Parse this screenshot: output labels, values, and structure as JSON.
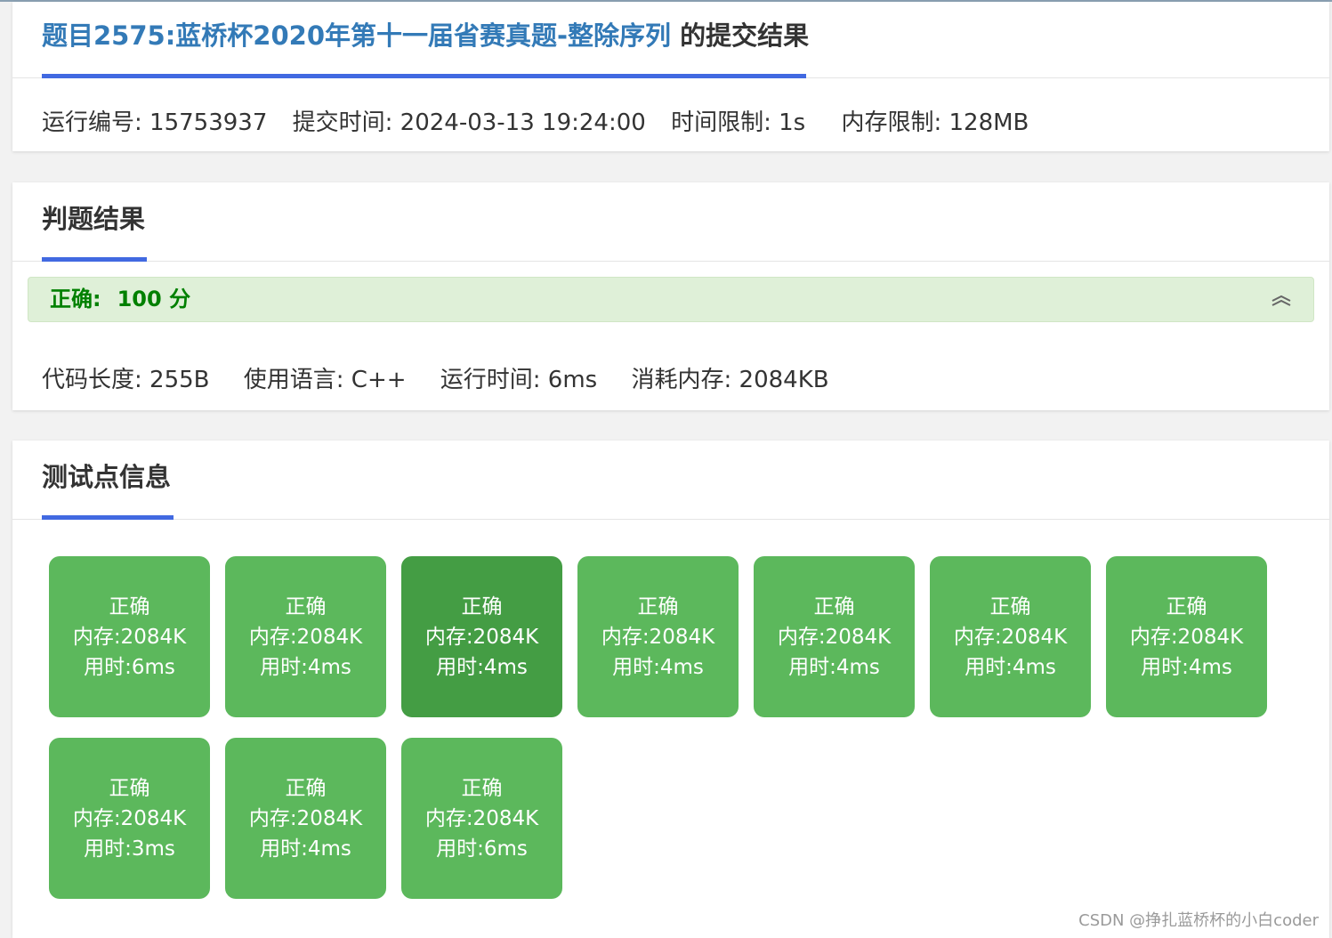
{
  "header": {
    "problem_link": "题目2575:蓝桥杯2020年第十一届省赛真题-整除序列",
    "title_suffix": " 的提交结果",
    "run_id": "运行编号: 15753937",
    "submit_time": "提交时间: 2024-03-13 19:24:00",
    "time_limit": "时间限制: 1s",
    "memory_limit": "内存限制: 128MB"
  },
  "judge": {
    "section_title": "判题结果",
    "verdict": "正确:",
    "score": "100 分",
    "code_length": "代码长度: 255B",
    "language": "使用语言: C++",
    "run_time": "运行时间: 6ms",
    "memory_used": "消耗内存: 2084KB"
  },
  "tests": {
    "section_title": "测试点信息",
    "items": [
      {
        "status": "正确",
        "memory": "内存:2084K",
        "time": "用时:6ms"
      },
      {
        "status": "正确",
        "memory": "内存:2084K",
        "time": "用时:4ms"
      },
      {
        "status": "正确",
        "memory": "内存:2084K",
        "time": "用时:4ms"
      },
      {
        "status": "正确",
        "memory": "内存:2084K",
        "time": "用时:4ms"
      },
      {
        "status": "正确",
        "memory": "内存:2084K",
        "time": "用时:4ms"
      },
      {
        "status": "正确",
        "memory": "内存:2084K",
        "time": "用时:4ms"
      },
      {
        "status": "正确",
        "memory": "内存:2084K",
        "time": "用时:4ms"
      },
      {
        "status": "正确",
        "memory": "内存:2084K",
        "time": "用时:3ms"
      },
      {
        "status": "正确",
        "memory": "内存:2084K",
        "time": "用时:4ms"
      },
      {
        "status": "正确",
        "memory": "内存:2084K",
        "time": "用时:6ms"
      }
    ]
  },
  "watermark": "CSDN @挣扎蓝桥杯的小白coder",
  "colors": {
    "accent": "#4169e1",
    "link": "#337ab7",
    "success_box": "#5cb85c",
    "success_box_hover": "#449d44",
    "verdict_text": "#008000",
    "verdict_bg": "#dff0d8"
  }
}
